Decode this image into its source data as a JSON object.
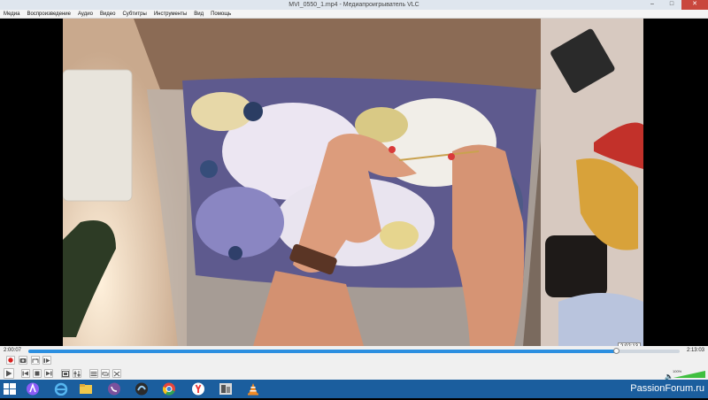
{
  "window": {
    "title": "MVI_0550_1.mp4 - Медиапроигрыватель VLC",
    "buttons": [
      "–",
      "□",
      "✕"
    ]
  },
  "menu": [
    "Медиа",
    "Воспроизведение",
    "Аудио",
    "Видео",
    "Субтитры",
    "Инструменты",
    "Вид",
    "Помощь"
  ],
  "player": {
    "elapsed": "2:00:07",
    "total": "2:13:03",
    "video_overlay_time": "2:02:13",
    "progress": 0.902,
    "volume_label": "100%",
    "volume": 1.0
  },
  "controls": {
    "top_row": [
      "record-icon",
      "snapshot-icon",
      "loop-ab-icon",
      "frame-step-icon"
    ],
    "bottom_row": [
      "play-icon",
      "previous-icon",
      "stop-icon",
      "next-icon",
      "fullscreen-icon",
      "extended-settings-icon",
      "playlist-icon",
      "loop-icon",
      "shuffle-icon"
    ]
  },
  "taskbar": {
    "apps": [
      "start-icon",
      "yandex-alice-icon",
      "internet-explorer-icon",
      "file-explorer-icon",
      "viber-icon",
      "edge-chromium-icon",
      "chrome-icon",
      "yandex-browser-icon",
      "photo-app-icon",
      "vlc-icon"
    ],
    "watermark": "PassionForum.ru"
  },
  "colors": {
    "accent": "#2c8fe0",
    "taskbar": "#1b5e9e",
    "record": "#d8201f"
  }
}
